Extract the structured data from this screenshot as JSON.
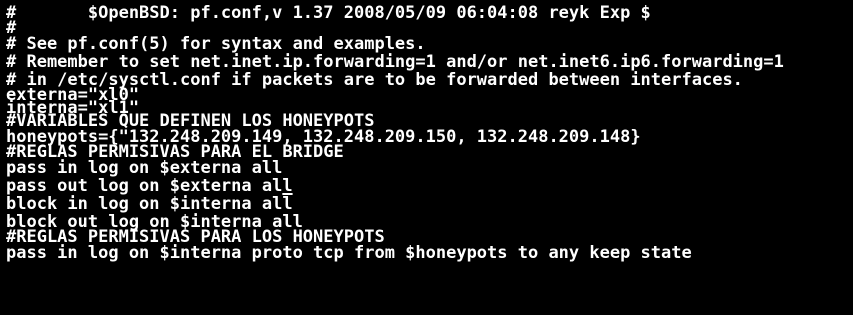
{
  "terminal": {
    "foreground": "#ffffff",
    "background": "#000000",
    "lines": [
      "#       $OpenBSD: pf.conf,v 1.37 2008/05/09 06:04:08 reyk Exp $",
      "#",
      "# See pf.conf(5) for syntax and examples.",
      "# Remember to set net.inet.ip.forwarding=1 and/or net.inet6.ip6.forwarding=1",
      "# in /etc/sysctl.conf if packets are to be forwarded between interfaces.",
      "externa=\"xl0\"",
      "interna=\"xl1\"",
      "#VARIABLES QUE DEFINEN LOS HONEYPOTS",
      "honeypots={\"132.248.209.149, 132.248.209.150, 132.248.209.148}",
      "#REGLAS PERMISIVAS PARA EL BRIDGE",
      "pass in log on $externa all",
      "pass out log on $externa al",
      "block in log on $interna all",
      "block out log on $interna all",
      "#REGLAS PERMISIVAS PARA LOS HONEYPOTS",
      "pass in log on $interna proto tcp from $honeypots to any keep state"
    ],
    "cursor_char": "l"
  }
}
